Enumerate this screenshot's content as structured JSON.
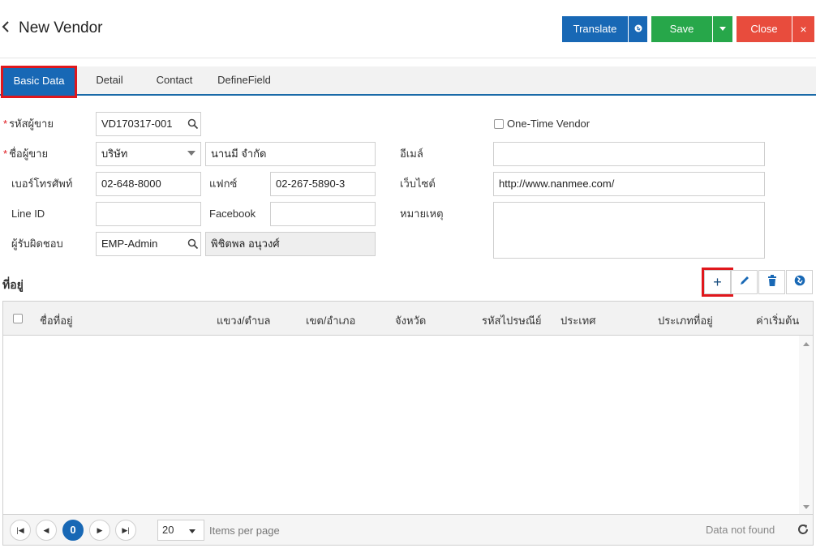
{
  "header": {
    "title": "New Vendor",
    "translate_label": "Translate",
    "save_label": "Save",
    "close_label": "Close",
    "close_x": "×"
  },
  "tabs": [
    {
      "label": "Basic Data",
      "active": true
    },
    {
      "label": "Detail"
    },
    {
      "label": "Contact"
    },
    {
      "label": "DefineField"
    }
  ],
  "form": {
    "vendor_code": {
      "label": "รหัสผู้ขาย",
      "value": "VD170317-001"
    },
    "vendor_name": {
      "label": "ชื่อผู้ขาย",
      "prefix": "บริษัท",
      "value": "นานมี จำกัด"
    },
    "phone": {
      "label": "เบอร์โทรศัพท์",
      "value": "02-648-8000"
    },
    "fax": {
      "label": "แฟกซ์",
      "value": "02-267-5890-3"
    },
    "line_id": {
      "label": "Line ID",
      "value": ""
    },
    "facebook": {
      "label": "Facebook",
      "value": ""
    },
    "responsible": {
      "label": "ผู้รับผิดชอบ",
      "value": "EMP-Admin",
      "name": "พิชิตพล อนุวงศ์"
    },
    "one_time_vendor": {
      "label": "One-Time Vendor",
      "checked": false
    },
    "email": {
      "label": "อีเมล์",
      "value": ""
    },
    "website": {
      "label": "เว็บไซต์",
      "value": "http://www.nanmee.com/"
    },
    "note": {
      "label": "หมายเหตุ",
      "value": ""
    }
  },
  "address": {
    "title": "ที่อยู่",
    "add_label": "+",
    "columns": [
      "ชื่อที่อยู่",
      "แขวง/ตำบล",
      "เขต/อำเภอ",
      "จังหวัด",
      "รหัสไปรษณีย์",
      "ประเทศ",
      "ประเภทที่อยู่",
      "ค่าเริ่มต้น"
    ],
    "rows": [],
    "pager": {
      "current_page": "0",
      "page_size": "20",
      "items_per_page_label": "Items per page",
      "status": "Data not found"
    }
  },
  "colors": {
    "primary": "#1868b5",
    "save": "#27a74a",
    "close": "#e84c3d",
    "highlight": "#e0171c"
  }
}
